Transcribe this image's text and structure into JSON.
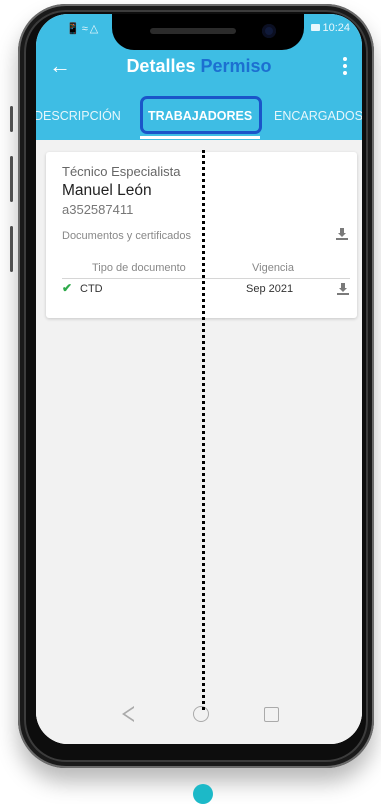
{
  "status_bar": {
    "left_icons": "📱≈△",
    "time": "10:24"
  },
  "app_bar": {
    "title_part1": "Detalles",
    "title_part2": "Permiso",
    "back_icon": "arrow-left-icon",
    "menu_icon": "more-vertical-icon"
  },
  "tabs": [
    {
      "label": "DESCRIPCIÓN",
      "active": false
    },
    {
      "label": "TRABAJADORES",
      "active": true
    },
    {
      "label": "ENCARGADOS",
      "active": false
    }
  ],
  "worker_card": {
    "role": "Técnico Especialista",
    "name": "Manuel León",
    "code": "a352587411",
    "documents_label": "Documentos y certificados",
    "table": {
      "headers": [
        "Tipo de documento",
        "Vigencia"
      ],
      "rows": [
        {
          "type": "CTD",
          "validity": "Sep 2021",
          "status_icon": "check-icon"
        }
      ]
    }
  },
  "colors": {
    "app_bar": "#3ebde4",
    "title_accent": "#1c6fd1",
    "highlight_border": "#1a55c9",
    "check": "#2eaa4a",
    "teal_dot": "#1cb9c8"
  }
}
